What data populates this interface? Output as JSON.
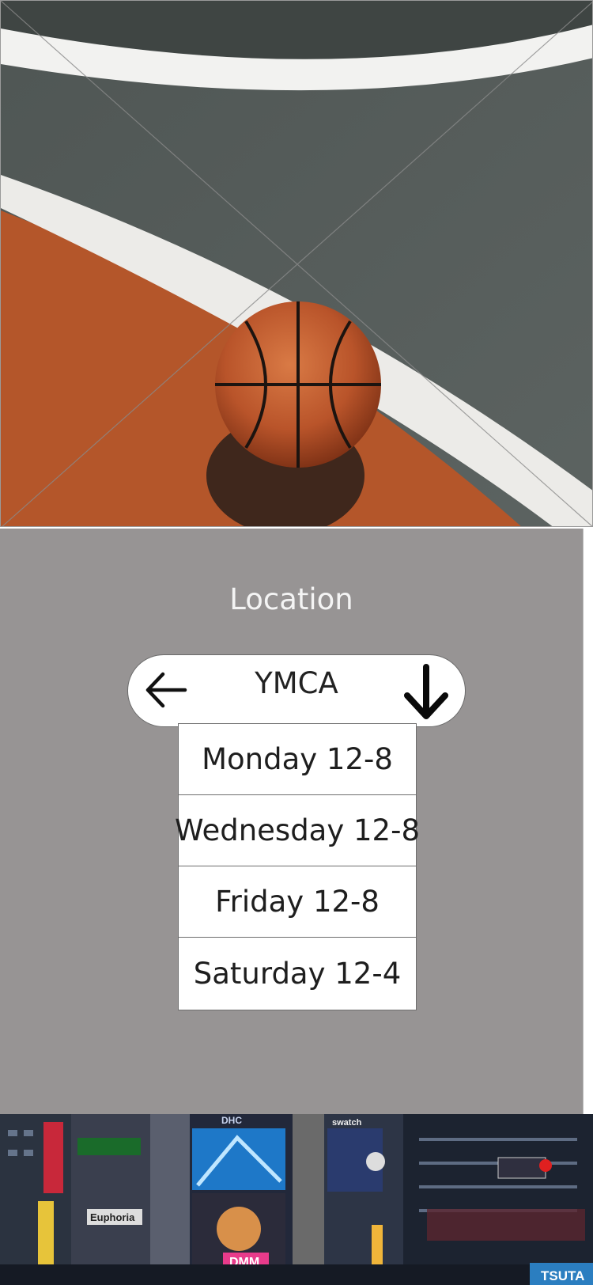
{
  "hero_image": {
    "alt": "basketball-court-photo"
  },
  "location": {
    "label": "Location",
    "selected": "YMCA",
    "back_icon": "arrow-left-icon",
    "dropdown_icon": "arrow-down-icon"
  },
  "schedule": {
    "rows": [
      {
        "text": "Monday 12-8"
      },
      {
        "text": "Wednesday 12-8"
      },
      {
        "text": "Friday 12-8"
      },
      {
        "text": "Saturday 12-4"
      }
    ]
  },
  "footer_image": {
    "alt": "city-street-neon-signs-photo",
    "signs": [
      "DHC",
      "swatch",
      "Euphoria",
      "DMM",
      "TSUTA"
    ]
  },
  "colors": {
    "panel_bg": "#979494",
    "court_gray": "#4d5452",
    "court_orange": "#b4562a",
    "ball": "#c25a2c"
  }
}
